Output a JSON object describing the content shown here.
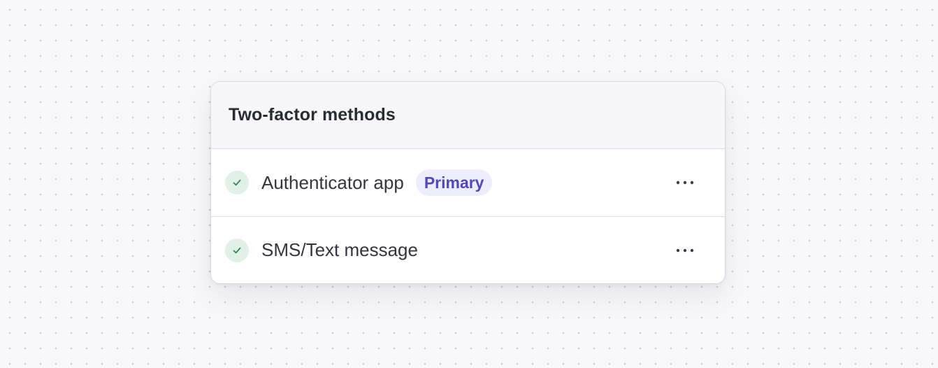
{
  "card": {
    "title": "Two-factor methods"
  },
  "methods": [
    {
      "label": "Authenticator app",
      "badge": "Primary",
      "status_icon": "check-icon",
      "menu_icon": "more-horizontal-icon"
    },
    {
      "label": "SMS/Text message",
      "status_icon": "check-icon",
      "menu_icon": "more-horizontal-icon"
    }
  ],
  "colors": {
    "badge_text": "#5248b8",
    "badge_bg": "#ededfb",
    "check": "#2e8a55",
    "check_bg": "#e2f1e8"
  }
}
